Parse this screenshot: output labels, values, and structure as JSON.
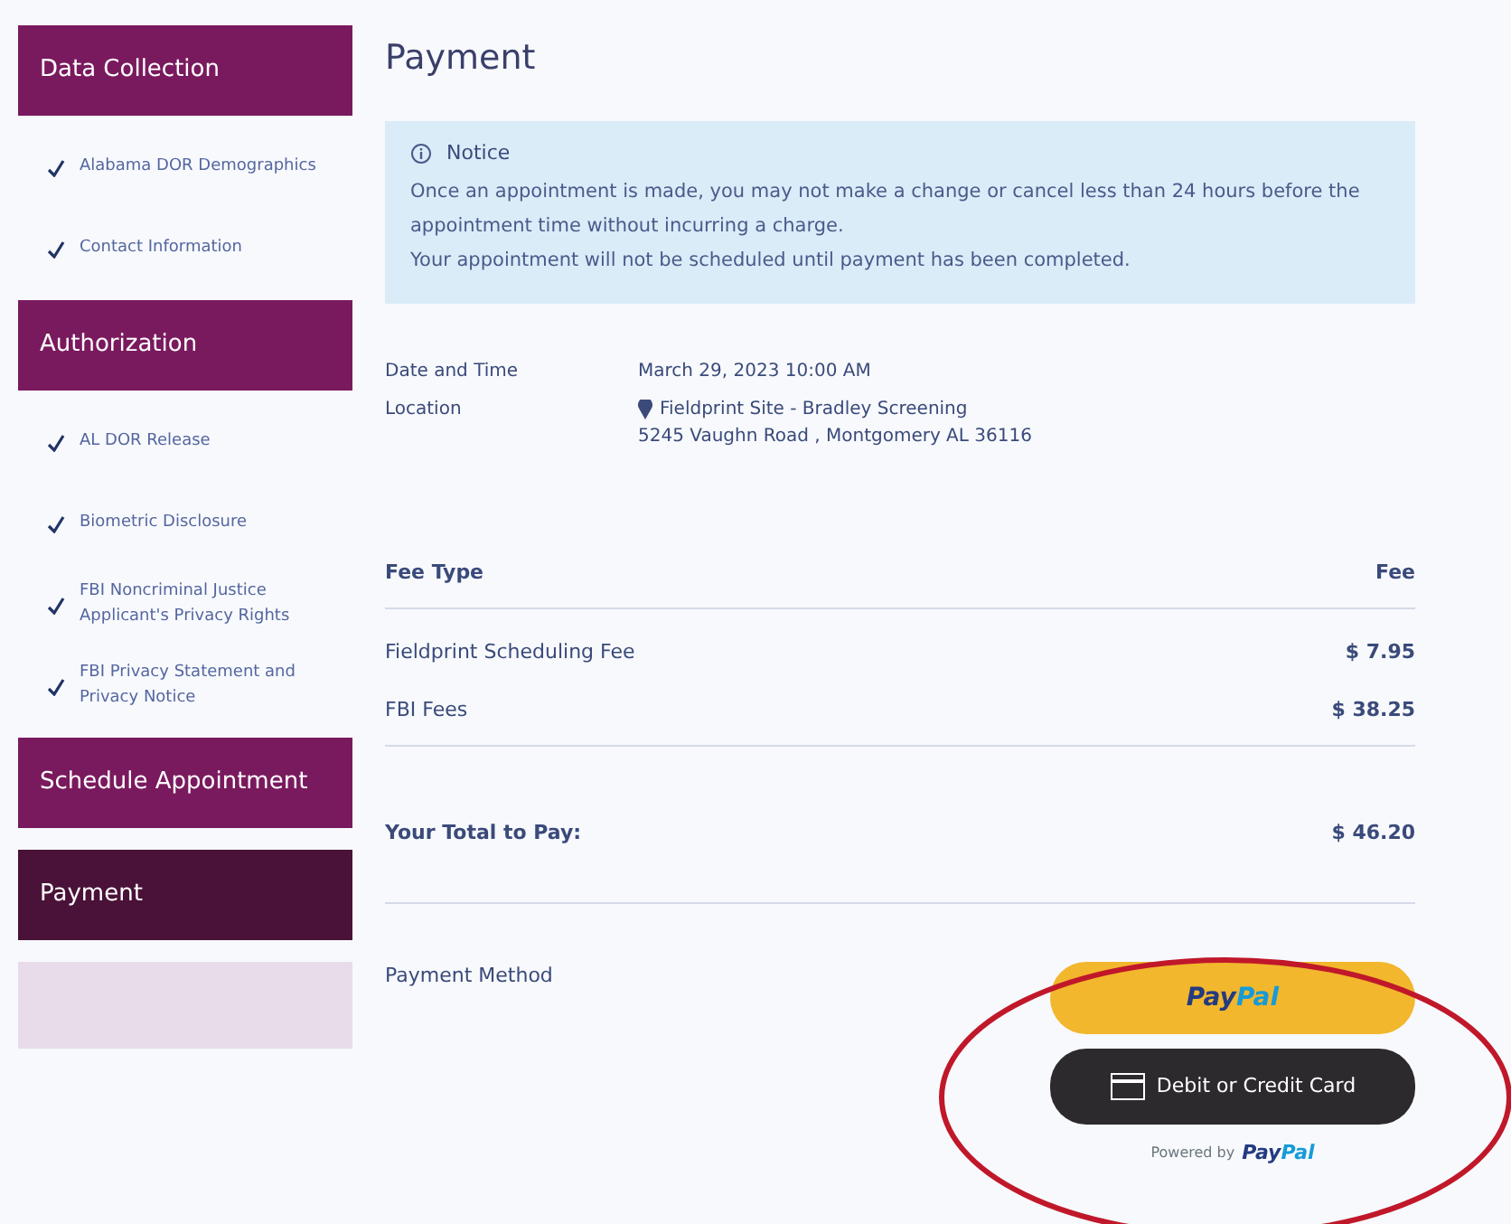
{
  "sidebar": {
    "items": [
      {
        "kind": "header",
        "label": "Data Collection",
        "selected": false
      },
      {
        "kind": "step",
        "label": "Alabama DOR Demographics",
        "checked": true
      },
      {
        "kind": "step",
        "label": "Contact Information",
        "checked": true
      },
      {
        "kind": "header",
        "label": "Authorization",
        "selected": false
      },
      {
        "kind": "step",
        "label": "AL DOR Release",
        "checked": true
      },
      {
        "kind": "step",
        "label": "Biometric Disclosure",
        "checked": true
      },
      {
        "kind": "step",
        "label": "FBI Noncriminal Justice Applicant's Privacy Rights",
        "checked": true
      },
      {
        "kind": "step",
        "label": "FBI Privacy Statement and Privacy Notice",
        "checked": true
      },
      {
        "kind": "header",
        "label": "Schedule Appointment",
        "selected": false
      },
      {
        "kind": "header",
        "label": "Payment",
        "selected": true
      },
      {
        "kind": "faded"
      }
    ]
  },
  "page_title": "Payment",
  "notice": {
    "title": "Notice",
    "lines": [
      "Once an appointment is made, you may not make a change or cancel less than 24 hours before the appointment time without incurring a charge.",
      "Your appointment will not be scheduled until payment has been completed."
    ]
  },
  "details": [
    {
      "label": "Date and Time",
      "values": [
        "March 29, 2023 10:00 AM"
      ]
    },
    {
      "label": "Location",
      "pin": true,
      "values": [
        "Fieldprint Site - Bradley Screening",
        "5245 Vaughn Road , Montgomery AL 36116"
      ]
    }
  ],
  "fees": {
    "columns": [
      "Fee Type",
      "Fee"
    ],
    "rows": [
      [
        "Fieldprint Scheduling Fee",
        "$ 7.95"
      ],
      [
        "FBI Fees",
        "$ 38.25"
      ]
    ],
    "total": [
      "Your Total to Pay:",
      "$ 46.20"
    ]
  },
  "payment_method": {
    "label": "Payment Method",
    "paypal": [
      "Pay",
      "Pal"
    ],
    "card_button": "Debit or Credit Card",
    "powered": [
      "Powered by",
      "Pay",
      "Pal"
    ]
  }
}
